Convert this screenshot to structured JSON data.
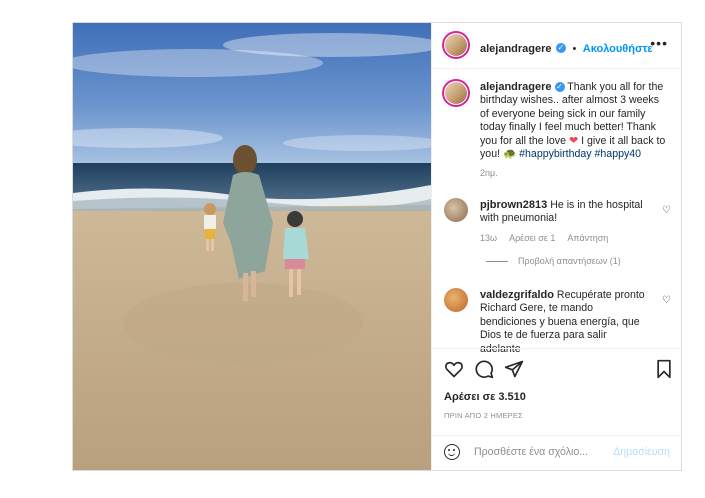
{
  "post": {
    "author": "alejandragere",
    "follow_label": "Ακολουθήστε",
    "bullet": "•",
    "more_label": "•••"
  },
  "caption": {
    "author": "alejandragere",
    "text_part1": "Thank you all for the birthday wishes.. after almost 3 weeks of everyone being sick in our family today finally I feel much better! Thank you for all the love",
    "heart_emoji": "❤",
    "text_part2": "I give it all back to you!",
    "turtle_emoji": "🐢",
    "hashtags": "#happybirthday #happy40",
    "time": "2nμ."
  },
  "comments": [
    {
      "author": "pjbrown2813",
      "text": "He is in the hospital with pneumonia!",
      "time": "13ω",
      "likes": "Αρέσει σε 1",
      "reply": "Απάντηση"
    },
    {
      "author": "valdezgrifaldo",
      "text": "Recupérate pronto Richard Gere, te mando bendiciones y buena energía, que Dios te de fuerza para salir adelante"
    }
  ],
  "view_replies": "Προβολή απαντήσεων (1)",
  "actions": {
    "likes": "Αρέσει σε 3.510",
    "date": "ΠΡΙΝ ΑΠΟ 2 ΗΜΕΡΕΣ"
  },
  "add_comment": {
    "placeholder": "Προσθέστε ένα σχόλιο...",
    "publish": "Δημοσίευση"
  },
  "colors": {
    "accent": "#0095f6",
    "verified": "#3897f0",
    "heart": "#ed4956"
  }
}
